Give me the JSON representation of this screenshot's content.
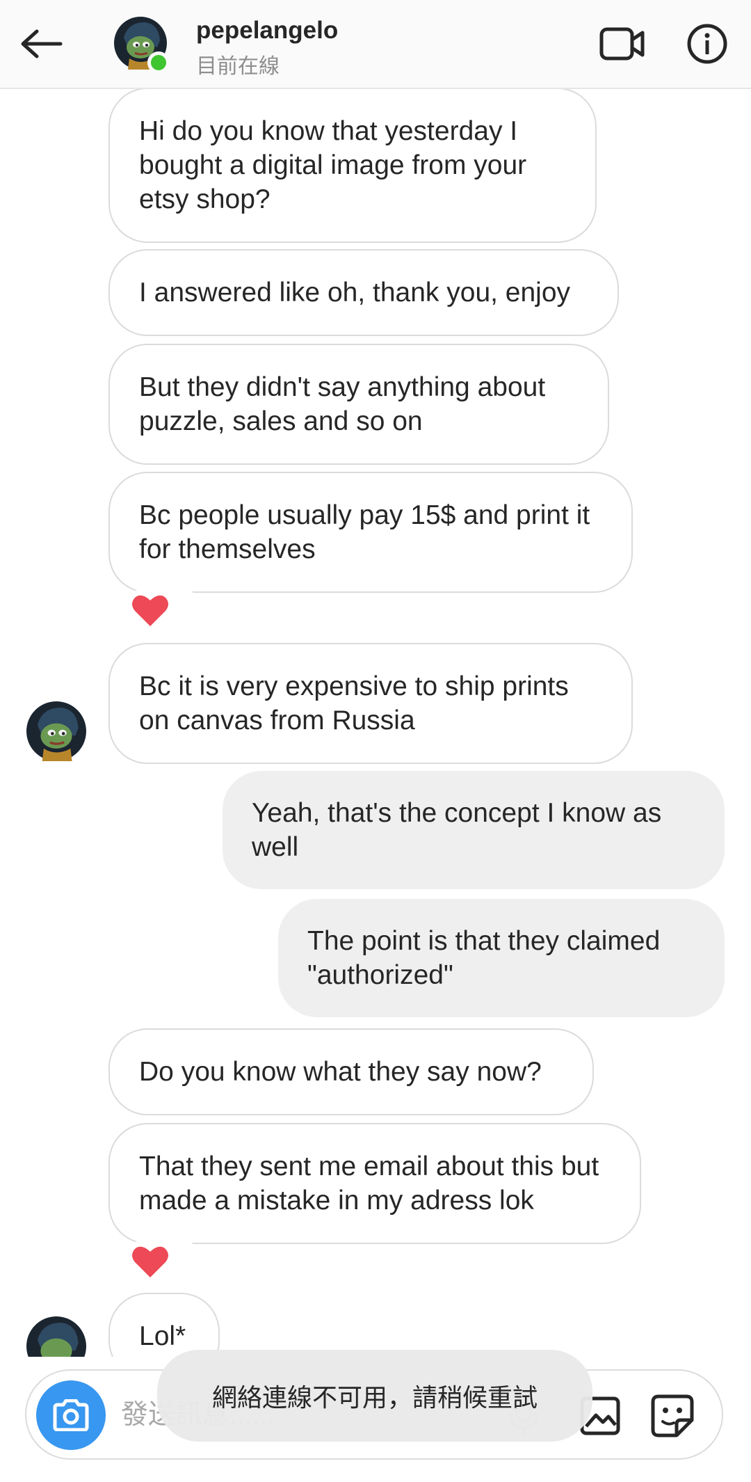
{
  "header": {
    "username": "pepelangelo",
    "status": "目前在線",
    "icons": {
      "back": "arrow-left-icon",
      "video": "video-camera-icon",
      "info": "info-icon"
    }
  },
  "messages": [
    {
      "direction": "in",
      "text": "Hi do you know that yesterday I bought a digital image from your etsy shop?"
    },
    {
      "direction": "in",
      "text": "I answered like oh, thank you, enjoy"
    },
    {
      "direction": "in",
      "text": "But they didn't say anything about puzzle, sales and so on"
    },
    {
      "direction": "in",
      "text": "Bc people usually pay 15$ and print it for themselves",
      "reaction": "heart"
    },
    {
      "direction": "in",
      "text": "Bc it is very expensive to ship prints on canvas from Russia",
      "avatar": true
    },
    {
      "direction": "out",
      "text": "Yeah, that's the concept I know as well"
    },
    {
      "direction": "out",
      "text": "The point is that they claimed \"authorized\""
    },
    {
      "direction": "in",
      "text": "Do you know what they say now?"
    },
    {
      "direction": "in",
      "text": "That they sent me email about this but made a mistake in my adress lok",
      "reaction": "heart"
    },
    {
      "direction": "in",
      "text": "Lol*",
      "avatar": true
    }
  ],
  "composer": {
    "placeholder": "發送訊息......",
    "icons": {
      "camera": "camera-icon",
      "mic": "microphone-icon",
      "gallery": "gallery-icon",
      "sticker": "sticker-icon"
    }
  },
  "toast": {
    "text": "網絡連線不可用，請稍候重試"
  },
  "colors": {
    "online": "#3ec52f",
    "heart": "#ed4956",
    "camera_bg": "#3897f0",
    "outgoing_bubble": "#efefef"
  }
}
